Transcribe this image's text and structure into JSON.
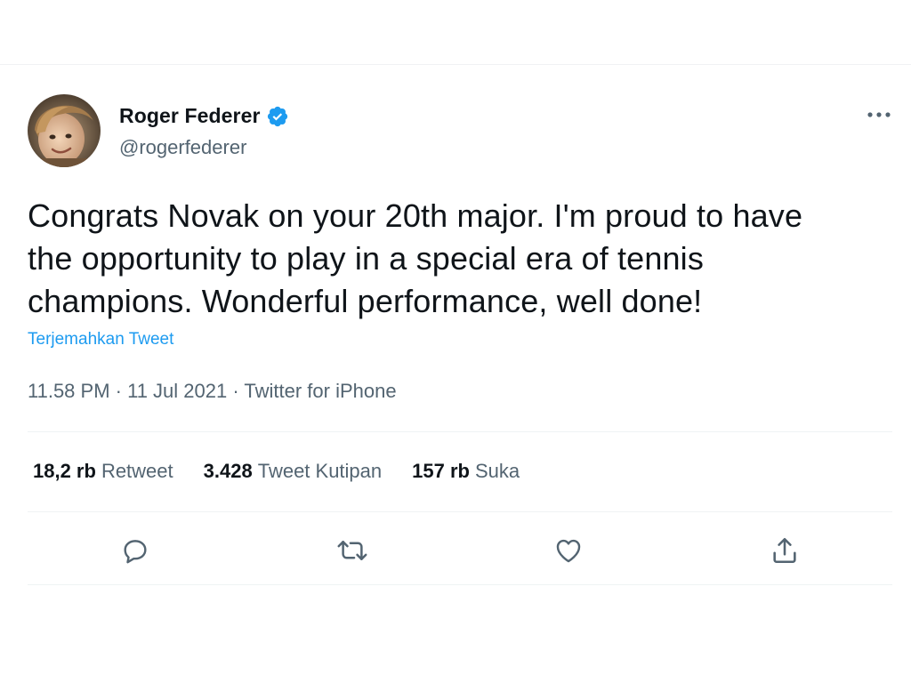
{
  "author": {
    "display_name": "Roger Federer",
    "handle": "@rogerfederer",
    "avatar_icon": "profile-photo",
    "verified_icon": "verified-badge-icon"
  },
  "more_icon": "more-options-icon",
  "tweet": {
    "text": "Congrats Novak on your 20th major. I'm proud to have\nthe opportunity to play in a special era of tennis\nchampions. Wonderful performance, well done!",
    "translate_label": "Terjemahkan Tweet",
    "time": "11.58 PM",
    "date": "11 Jul 2021",
    "source": "Twitter for iPhone",
    "separator": " · "
  },
  "stats": {
    "retweets": {
      "value": "18,2 rb",
      "label": "Retweet"
    },
    "quotes": {
      "value": "3.428",
      "label": "Tweet Kutipan"
    },
    "likes": {
      "value": "157 rb",
      "label": "Suka"
    }
  },
  "actions": [
    "reply-icon",
    "retweet-icon",
    "like-icon",
    "share-icon"
  ],
  "colors": {
    "accent": "#1d9bf0",
    "text": "#0f1419",
    "secondary": "#536471",
    "divider": "#eff3f4"
  }
}
